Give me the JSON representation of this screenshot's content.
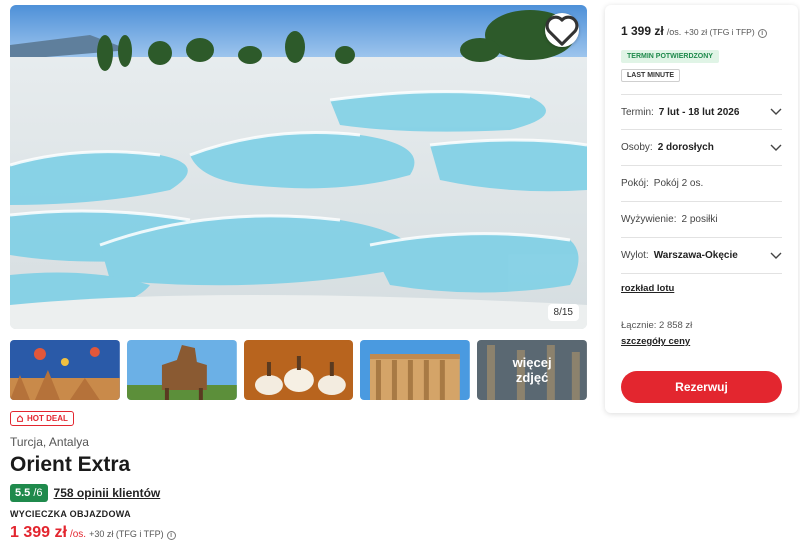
{
  "gallery": {
    "counter": "8/15",
    "more_label": "więcej zdjęć"
  },
  "offer": {
    "hot_deal": "HOT DEAL",
    "location": "Turcja, Antalya",
    "name": "Orient Extra",
    "rating": "5.5",
    "rating_max": "/6",
    "reviews": "758 opinii klientów",
    "trip_type": "WYCIECZKA OBJAZDOWA",
    "price": "1 399 zł",
    "price_unit": "/os.",
    "price_extra": "+30 zł (TFG i TFP)"
  },
  "sidebar": {
    "price": "1 399 zł",
    "price_unit": "/os.",
    "price_extra": "+30 zł (TFG i TFP)",
    "tag_confirmed": "TERMIN POTWIERDZONY",
    "tag_last_minute": "LAST MINUTE",
    "term_label": "Termin:",
    "term_value": "7 lut - 18 lut 2026",
    "persons_label": "Osoby:",
    "persons_value": "2 dorosłych",
    "room_label": "Pokój:",
    "room_value": "Pokój 2 os.",
    "board_label": "Wyżywienie:",
    "board_value": "2 posiłki",
    "departure_label": "Wylot:",
    "departure_value": "Warszawa-Okęcie",
    "flight_schedule": "rozkład lotu",
    "total": "Łącznie: 2 858 zł",
    "price_details": "szczegóły ceny",
    "reserve": "Rezerwuj"
  },
  "colors": {
    "accent_red": "#e3262f",
    "rating_green": "#1f8a4c",
    "tag_green_bg": "#e0f4e6"
  },
  "icons": [
    "heart-icon",
    "hot-deal-icon",
    "info-icon",
    "chevron-down-icon"
  ]
}
